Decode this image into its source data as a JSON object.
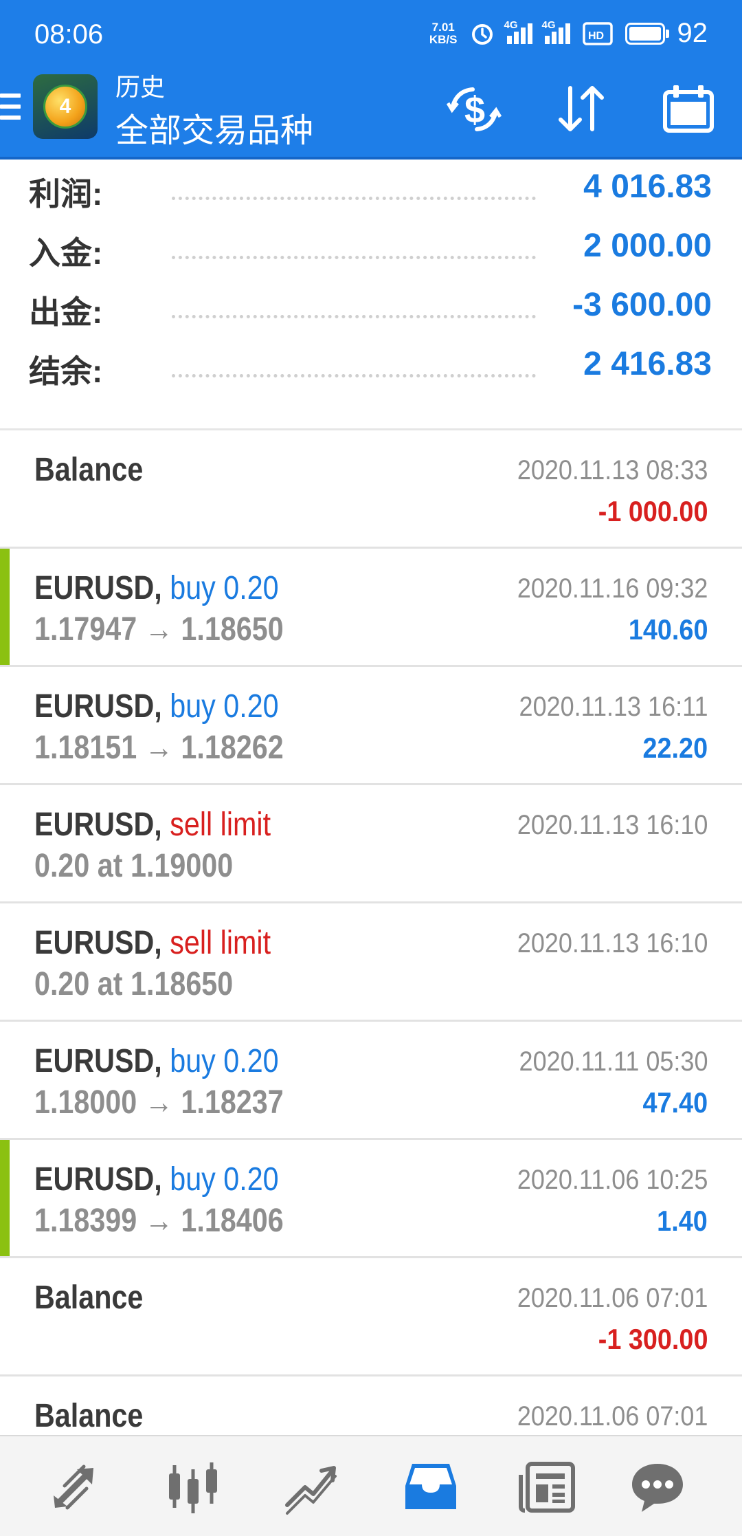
{
  "status_bar": {
    "time": "08:06",
    "net_speed_top": "7.01",
    "net_speed_bottom": "KB/S",
    "sig1": "4G",
    "sig2": "4G",
    "hd": "HD",
    "battery": "92"
  },
  "app_bar": {
    "subtitle": "历史",
    "title": "全部交易品种"
  },
  "summary": [
    {
      "label": "利润:",
      "value": "4 016.83"
    },
    {
      "label": "入金:",
      "value": "2 000.00"
    },
    {
      "label": "出金:",
      "value": "-3 600.00"
    },
    {
      "label": "结余:",
      "value": "2 416.83"
    }
  ],
  "deals": [
    {
      "symbol": "Balance",
      "action": "",
      "prices": "",
      "time": "2020.11.13 08:33",
      "profit": "-1 000.00"
    },
    {
      "symbol": "EURUSD,",
      "action": "buy 0.20",
      "prices": "1.17947 → 1.18650",
      "time": "2020.11.16 09:32",
      "profit": "140.60"
    },
    {
      "symbol": "EURUSD,",
      "action": "buy 0.20",
      "prices": "1.18151 → 1.18262",
      "time": "2020.11.13 16:11",
      "profit": "22.20"
    },
    {
      "symbol": "EURUSD,",
      "action": "sell limit",
      "prices": "0.20 at 1.19000",
      "time": "2020.11.13 16:10",
      "profit": ""
    },
    {
      "symbol": "EURUSD,",
      "action": "sell limit",
      "prices": "0.20 at 1.18650",
      "time": "2020.11.13 16:10",
      "profit": ""
    },
    {
      "symbol": "EURUSD,",
      "action": "buy 0.20",
      "prices": "1.18000 → 1.18237",
      "time": "2020.11.11 05:30",
      "profit": "47.40"
    },
    {
      "symbol": "EURUSD,",
      "action": "buy 0.20",
      "prices": "1.18399 → 1.18406",
      "time": "2020.11.06 10:25",
      "profit": "1.40"
    },
    {
      "symbol": "Balance",
      "action": "",
      "prices": "",
      "time": "2020.11.06 07:01",
      "profit": "-1 300.00"
    },
    {
      "symbol": "Balance",
      "action": "",
      "prices": "",
      "time": "2020.11.06 07:01",
      "profit": ""
    }
  ],
  "colors": {
    "primary": "#1e7ee8",
    "positive": "#1a7be0",
    "negative": "#d8201f",
    "win_marker": "#8bc111"
  },
  "bottom_nav": [
    "quotes-icon",
    "chart-icon",
    "trade-icon",
    "history-icon",
    "news-icon",
    "messages-icon"
  ]
}
